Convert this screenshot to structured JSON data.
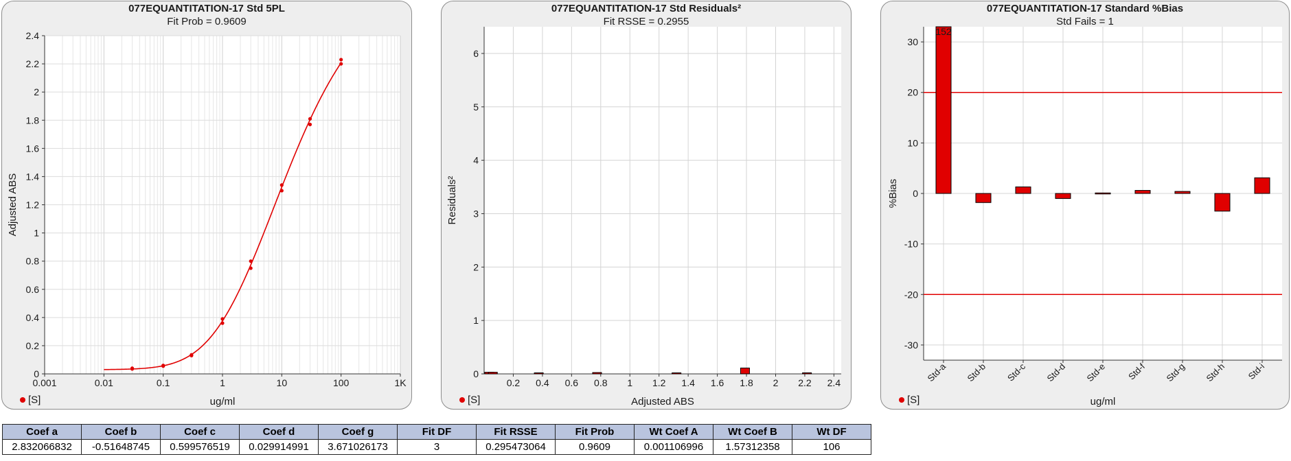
{
  "colors": {
    "series": "#e00000",
    "grid": "#d4d4d4",
    "panel": "#eeeeee",
    "header": "#b9c4de"
  },
  "panels": [
    {
      "title": "077EQUANTITATION-17  Std 5PL",
      "subtitle": "Fit Prob = 0.9609",
      "legend": "[S]"
    },
    {
      "title": "077EQUANTITATION-17  Std  Residuals²",
      "subtitle": "Fit RSSE = 0.2955",
      "legend": "[S]"
    },
    {
      "title": "077EQUANTITATION-17  Standard %Bias",
      "subtitle": "Std Fails = 1",
      "legend": "[S]"
    }
  ],
  "chart_data": [
    {
      "type": "scatter",
      "title": "077EQUANTITATION-17  Std 5PL",
      "subtitle": "Fit Prob = 0.9609",
      "xlabel": "ug/ml",
      "ylabel": "Adjusted ABS",
      "xscale": "log",
      "xlim": [
        0.001,
        1000
      ],
      "ylim": [
        0,
        2.4
      ],
      "x_ticks": [
        0.001,
        0.01,
        0.1,
        1,
        10,
        100,
        1000
      ],
      "x_tick_labels": [
        "0.001",
        "0.01",
        "0.1",
        "1",
        "10",
        "100",
        "1K"
      ],
      "y_ticks": [
        0,
        0.2,
        0.4,
        0.6,
        0.8,
        1,
        1.2,
        1.4,
        1.6,
        1.8,
        2,
        2.2,
        2.4
      ],
      "y_tick_labels": [
        "0",
        "0.2",
        "0.4",
        "0.6",
        "0.8",
        "1",
        "1.2",
        "1.4",
        "1.6",
        "1.8",
        "2",
        "2.2",
        "2.4"
      ],
      "grid": true,
      "legend": "bottom-left",
      "series": [
        {
          "name": "[S]",
          "points": [
            [
              0.03,
              0.035
            ],
            [
              0.03,
              0.04
            ],
            [
              0.1,
              0.055
            ],
            [
              0.1,
              0.06
            ],
            [
              0.3,
              0.13
            ],
            [
              0.3,
              0.135
            ],
            [
              1,
              0.36
            ],
            [
              1,
              0.39
            ],
            [
              3,
              0.75
            ],
            [
              3,
              0.8
            ],
            [
              10,
              1.3
            ],
            [
              10,
              1.34
            ],
            [
              30,
              1.77
            ],
            [
              30,
              1.81
            ],
            [
              100,
              2.2
            ],
            [
              100,
              2.23
            ]
          ]
        }
      ],
      "fit_curve": {
        "model": "5PL",
        "a": 2.832066832,
        "b": -0.51648745,
        "c": 0.599576519,
        "d": 0.029914991,
        "g": 3.671026173,
        "x_range": [
          0.01,
          100
        ]
      }
    },
    {
      "type": "bar",
      "title": "077EQUANTITATION-17  Std  Residuals²",
      "subtitle": "Fit RSSE = 0.2955",
      "xlabel": "Adjusted ABS",
      "ylabel": "Residuals²",
      "xlim": [
        0,
        2.45
      ],
      "ylim": [
        0,
        6.5
      ],
      "x_ticks": [
        0.2,
        0.4,
        0.6,
        0.8,
        1,
        1.2,
        1.4,
        1.6,
        1.8,
        2,
        2.2,
        2.4
      ],
      "x_tick_labels": [
        "0.2",
        "0.4",
        "0.6",
        "0.8",
        "1",
        "1.2",
        "1.4",
        "1.6",
        "1.8",
        "2",
        "2.2",
        "2.4"
      ],
      "y_ticks": [
        0,
        1,
        2,
        3,
        4,
        5,
        6
      ],
      "y_tick_labels": [
        "0",
        "1",
        "2",
        "3",
        "4",
        "5",
        "6"
      ],
      "grid": true,
      "legend": "bottom-left",
      "bars": [
        {
          "x": 0.035,
          "value": 0.03
        },
        {
          "x": 0.06,
          "value": 0.03
        },
        {
          "x": 0.375,
          "value": 0.01
        },
        {
          "x": 0.775,
          "value": 0.025
        },
        {
          "x": 1.32,
          "value": 0.005
        },
        {
          "x": 1.79,
          "value": 0.11
        },
        {
          "x": 2.215,
          "value": 0.02
        }
      ]
    },
    {
      "type": "bar",
      "title": "077EQUANTITATION-17  Standard %Bias",
      "subtitle": "Std Fails = 1",
      "xlabel": "ug/ml",
      "ylabel": "%Bias",
      "categories": [
        "Std-a",
        "Std-b",
        "Std-c",
        "Std-d",
        "Std-e",
        "Std-f",
        "Std-g",
        "Std-h",
        "Std-i"
      ],
      "values": [
        152,
        -1.8,
        1.3,
        -1.0,
        0.1,
        0.6,
        0.4,
        -3.5,
        3.1
      ],
      "ylim": [
        -33,
        33
      ],
      "y_ticks": [
        -30,
        -20,
        -10,
        0,
        10,
        20,
        30
      ],
      "y_tick_labels": [
        "-30",
        "-20",
        "-10",
        "0",
        "10",
        "20",
        "30"
      ],
      "limit_lines": [
        20,
        -20
      ],
      "annotations": [
        {
          "category": "Std-a",
          "text": "152"
        }
      ],
      "grid": true,
      "legend": "bottom-left"
    }
  ],
  "table": {
    "headers": [
      "Coef a",
      "Coef b",
      "Coef c",
      "Coef d",
      "Coef g",
      "Fit DF",
      "Fit RSSE",
      "Fit Prob",
      "Wt Coef A",
      "Wt Coef B",
      "Wt DF"
    ],
    "rows": [
      [
        "2.832066832",
        "-0.51648745",
        "0.599576519",
        "0.029914991",
        "3.671026173",
        "3",
        "0.295473064",
        "0.9609",
        "0.001106996",
        "1.57312358",
        "106"
      ]
    ]
  }
}
